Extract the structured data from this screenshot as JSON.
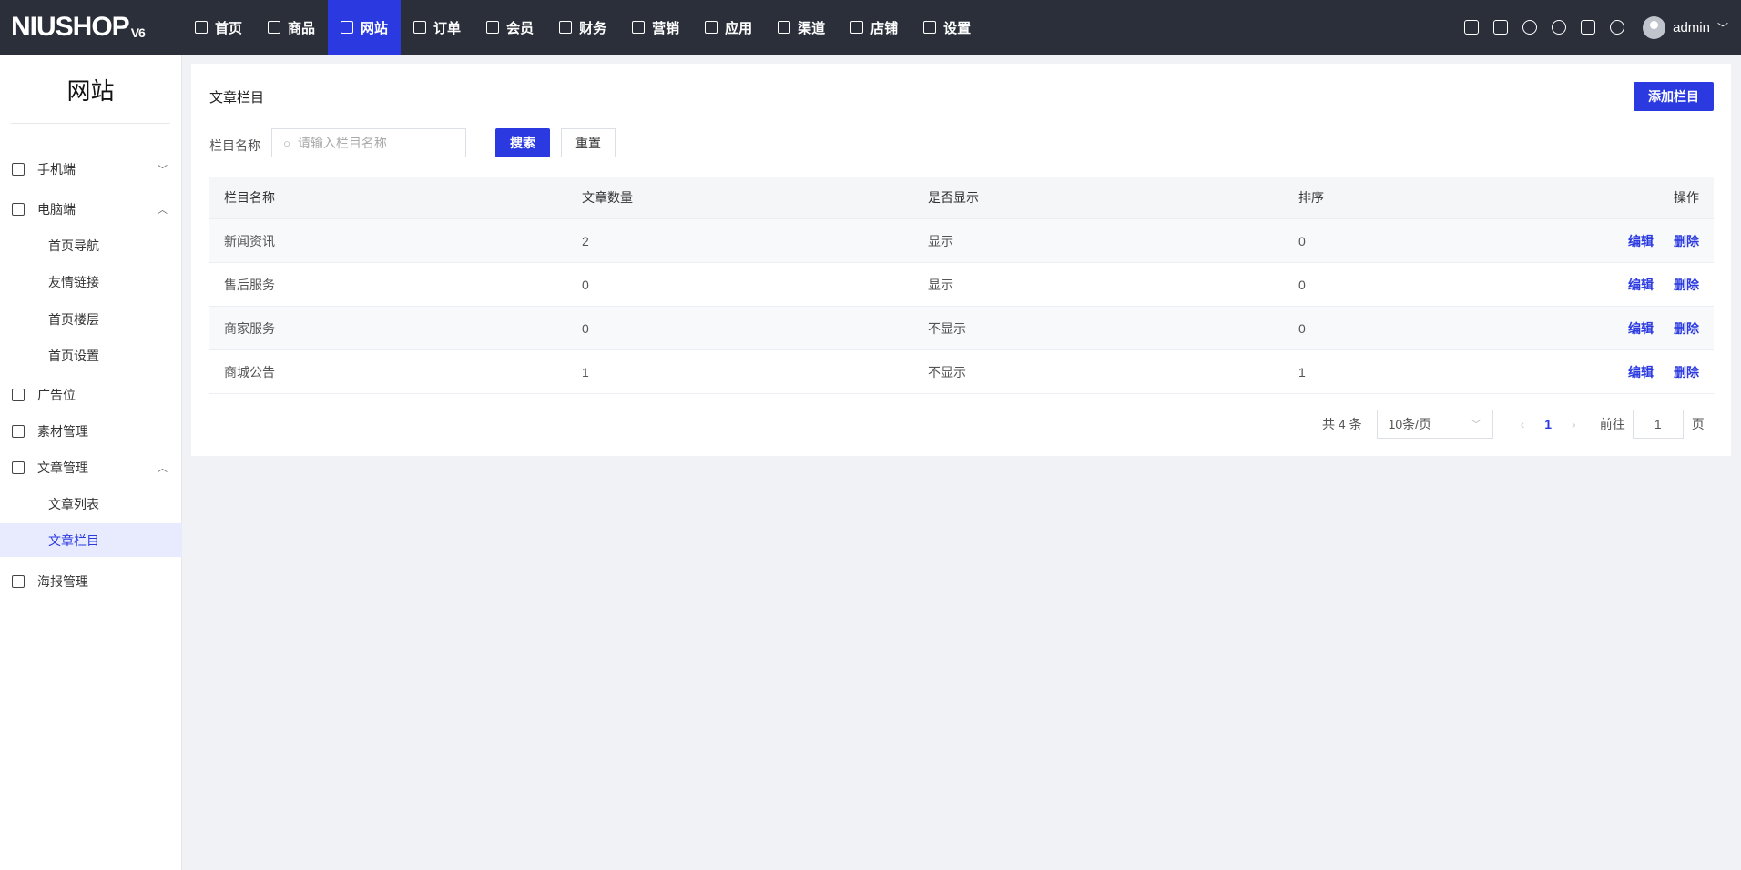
{
  "header": {
    "logo": "NIUSHOP",
    "logo_version": "V6",
    "nav": [
      {
        "label": "首页",
        "icon": "monitor-icon"
      },
      {
        "label": "商品",
        "icon": "goods-icon"
      },
      {
        "label": "网站",
        "icon": "website-icon",
        "active": true
      },
      {
        "label": "订单",
        "icon": "order-icon"
      },
      {
        "label": "会员",
        "icon": "member-icon"
      },
      {
        "label": "财务",
        "icon": "finance-icon"
      },
      {
        "label": "营销",
        "icon": "marketing-icon"
      },
      {
        "label": "应用",
        "icon": "app-icon"
      },
      {
        "label": "渠道",
        "icon": "channel-icon"
      },
      {
        "label": "店铺",
        "icon": "store-icon"
      },
      {
        "label": "设置",
        "icon": "settings-icon"
      }
    ],
    "user": "admin"
  },
  "sidebar": {
    "title": "网站",
    "items": [
      {
        "label": "手机端",
        "type": "group",
        "expanded": false
      },
      {
        "label": "电脑端",
        "type": "group",
        "expanded": true
      },
      {
        "label": "首页导航",
        "type": "sub"
      },
      {
        "label": "友情链接",
        "type": "sub"
      },
      {
        "label": "首页楼层",
        "type": "sub"
      },
      {
        "label": "首页设置",
        "type": "sub"
      },
      {
        "label": "广告位",
        "type": "item"
      },
      {
        "label": "素材管理",
        "type": "item"
      },
      {
        "label": "文章管理",
        "type": "group",
        "expanded": true
      },
      {
        "label": "文章列表",
        "type": "sub"
      },
      {
        "label": "文章栏目",
        "type": "sub",
        "active": true
      },
      {
        "label": "海报管理",
        "type": "item"
      }
    ]
  },
  "main": {
    "title": "文章栏目",
    "add_button": "添加栏目",
    "search_label": "栏目名称",
    "search_placeholder": "请输入栏目名称",
    "search_button": "搜索",
    "reset_button": "重置",
    "columns": [
      "栏目名称",
      "文章数量",
      "是否显示",
      "排序",
      "操作"
    ],
    "rows": [
      {
        "name": "新闻资讯",
        "count": "2",
        "show": "显示",
        "sort": "0"
      },
      {
        "name": "售后服务",
        "count": "0",
        "show": "显示",
        "sort": "0"
      },
      {
        "name": "商家服务",
        "count": "0",
        "show": "不显示",
        "sort": "0"
      },
      {
        "name": "商城公告",
        "count": "1",
        "show": "不显示",
        "sort": "1"
      }
    ],
    "edit": "编辑",
    "delete": "删除",
    "pagination": {
      "total": "共 4 条",
      "page_size": "10条/页",
      "current": "1",
      "goto_label": "前往",
      "goto_value": "1",
      "page_unit": "页"
    }
  },
  "colors": {
    "accent": "#2a39e0",
    "header": "#2b2f3a"
  }
}
